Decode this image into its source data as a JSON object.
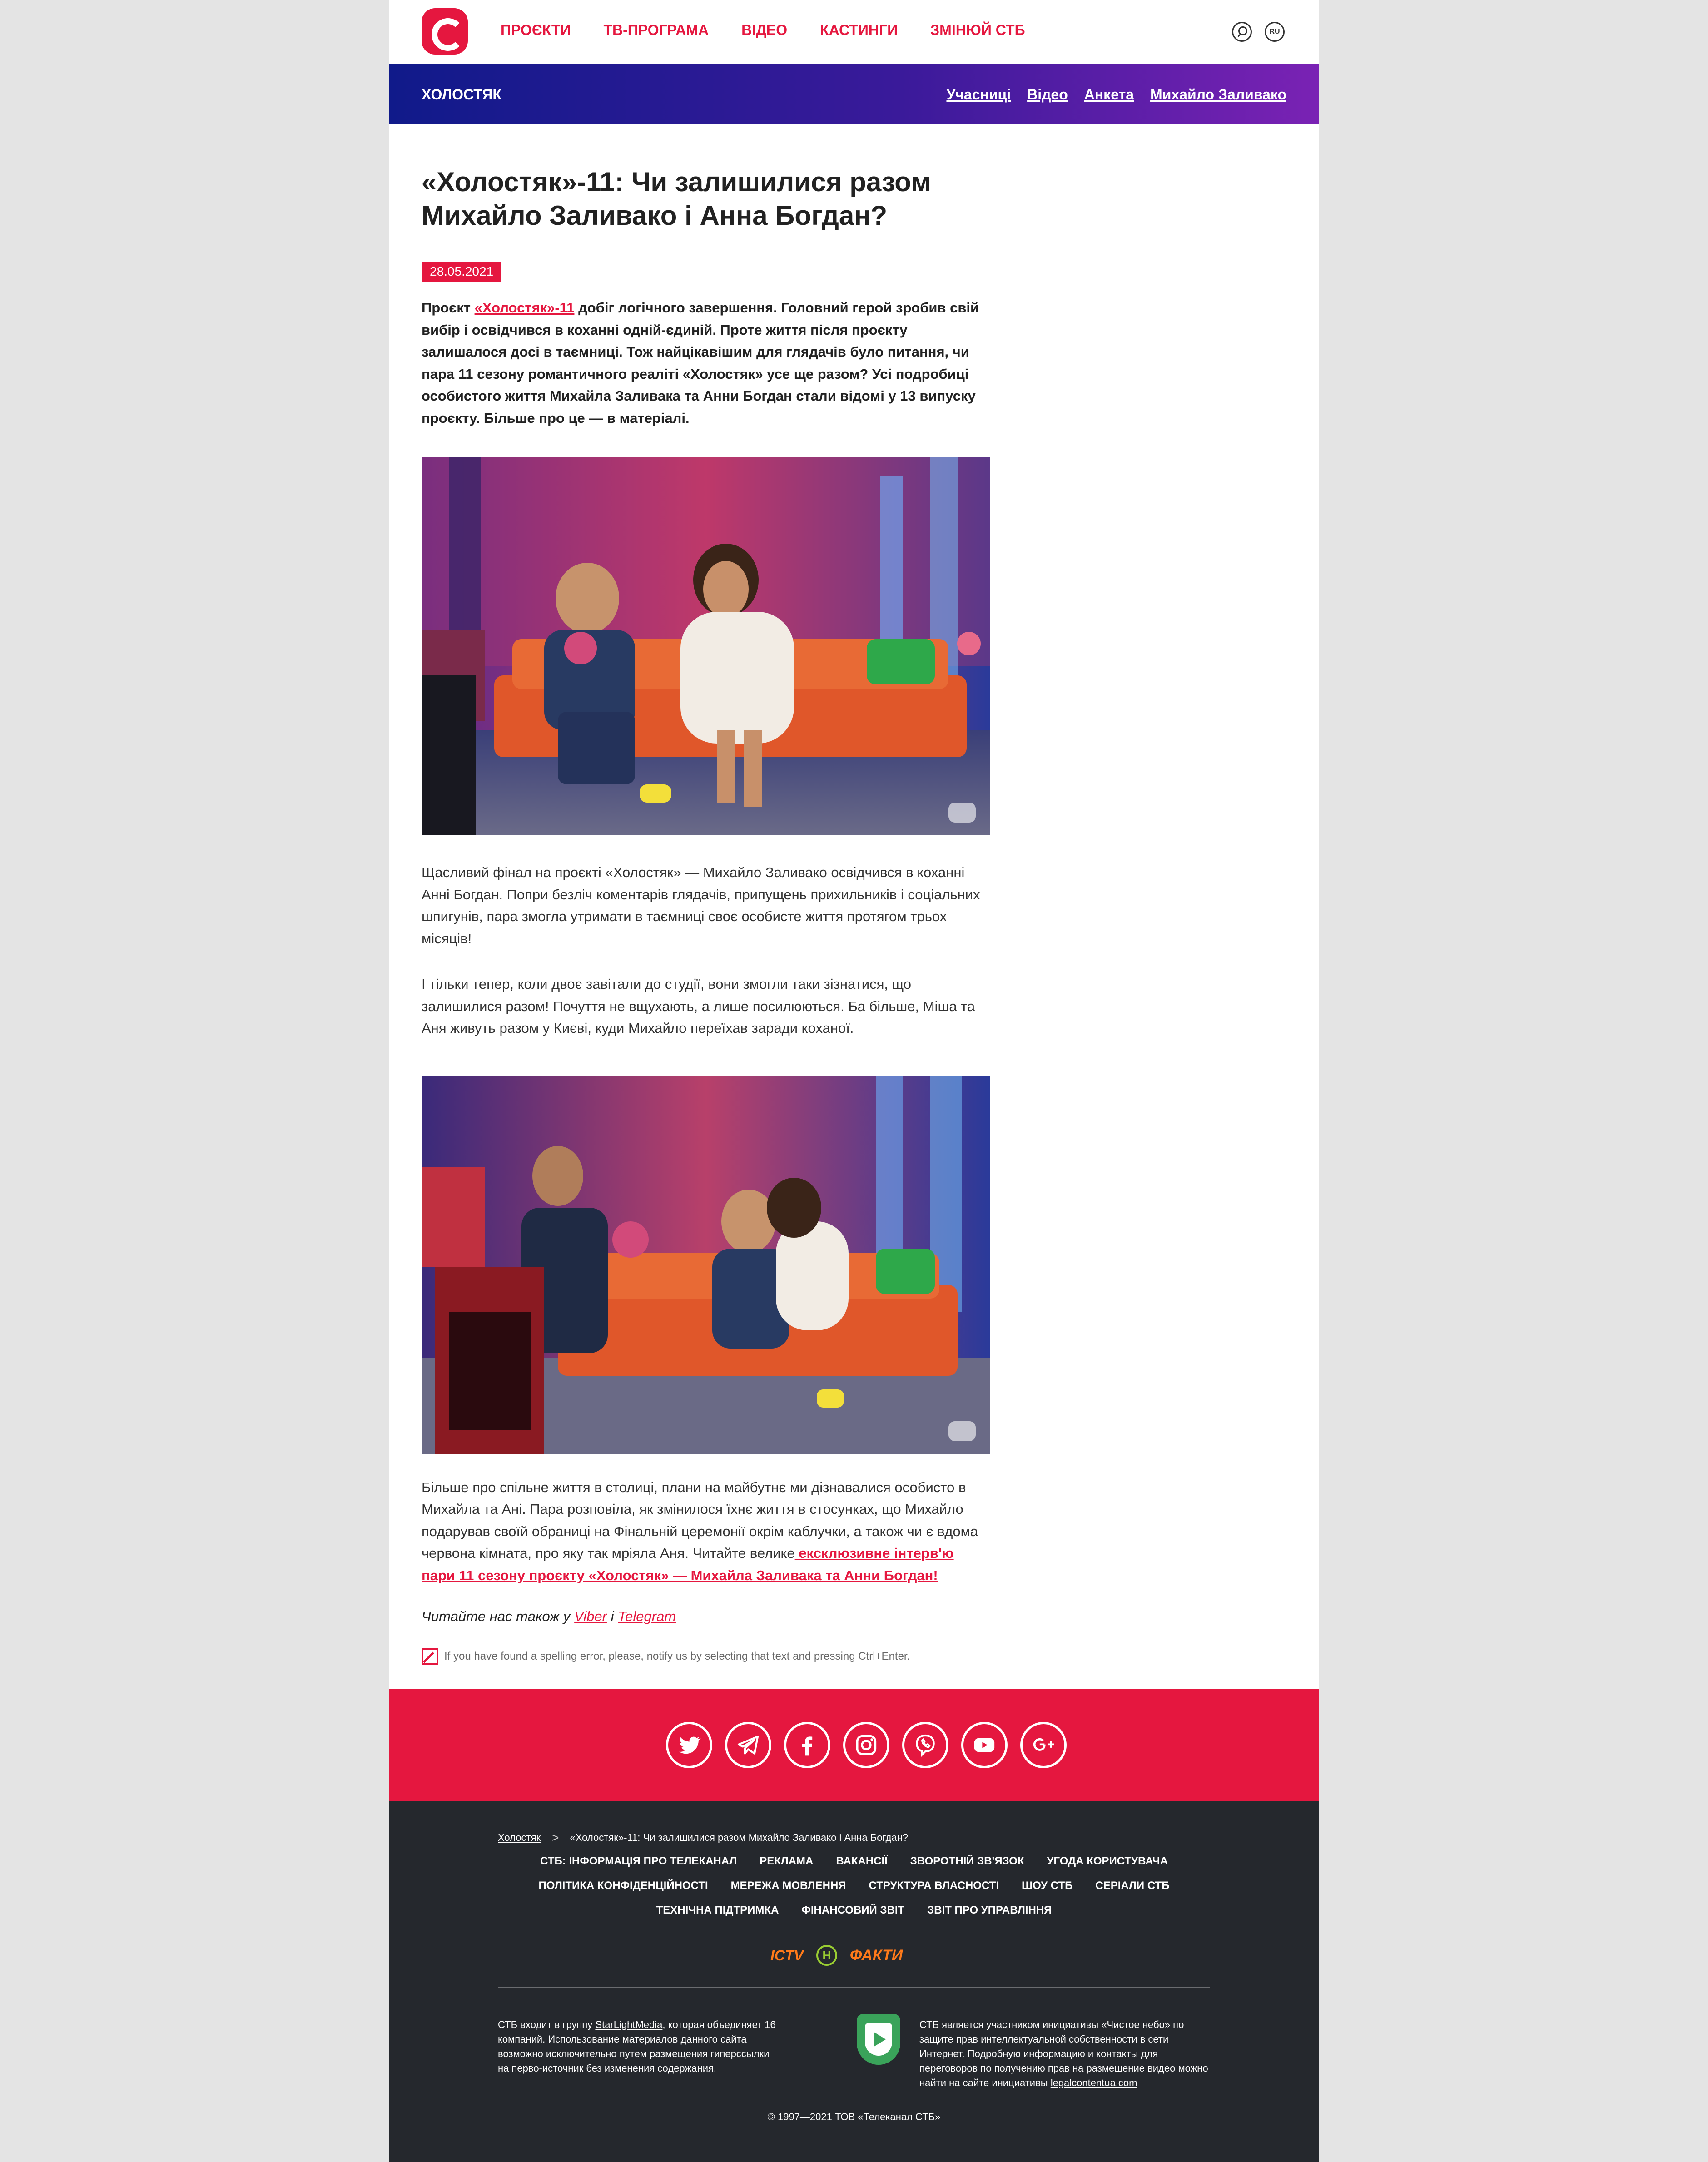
{
  "header": {
    "nav": [
      "ПРОЄКТИ",
      "ТВ-ПРОГРАМА",
      "ВІДЕО",
      "КАСТИНГИ",
      "ЗМІНЮЙ СТБ"
    ],
    "lang": "RU",
    "logo_icon": "stb-logo-icon",
    "search_icon": "search-icon"
  },
  "project_bar": {
    "title": "ХОЛОСТЯК",
    "links": [
      "Учасниці",
      "Відео",
      "Анкета",
      "Михайло Заливако"
    ]
  },
  "article": {
    "title": "«Холостяк»-11: Чи залишилися разом Михайло Заливако і Анна Богдан?",
    "date": "28.05.2021",
    "lead_before": "Проєкт ",
    "lead_link": "«Холостяк»-11",
    "lead_after": " добіг логічного завершення. Головний герой зробив свій вибір і освідчився в коханні одній-єдиній. Проте життя після проєкту залишалося досі в таємниці. Тож найцікавішим для глядачів було питання, чи пара 11 сезону романтичного реаліті «Холостяк» усе ще разом? Усі подробиці особистого життя Михайла Заливака та Анни Богдан стали відомі у 13 випуску проєкту. Більше про це — в матеріалі.",
    "paragraph1": "Щасливий фінал на проєкті «Холостяк» — Михайло Заливако освідчився в коханні Анні Богдан. Попри безліч коментарів глядачів, припущень прихильників і соціальних шпигунів, пара змогла утримати в таємниці своє особисте життя протягом трьох місяців!",
    "paragraph2": "І тільки тепер, коли двоє завітали до студії, вони змогли таки зізнатися, що залишилися разом! Почуття не вщухають, а лише посилюються. Ба більше, Міша та Аня живуть разом у Києві, куди Михайло переїхав заради коханої.",
    "paragraph3_text": "Більше про спільне життя в столиці, плани на майбутнє ми дізнавалися особисто в Михайла та Ані. Пара розповіла, як змінилося їхнє життя в стосунках, що Михайло подарував своїй обраниці на Фінальній церемонії окрім каблучки, а також чи є вдома червона кімната, про яку так мріяла Аня. Читайте велике",
    "paragraph3_link": " ексклюзивне інтерв'ю пари 11 сезону проєкту «Холостяк» — Михайла Заливака та Анни Богдан!",
    "read_us_text": "Читайте нас також у ",
    "read_us_viber": "Viber",
    "read_us_and": " і ",
    "read_us_telegram": "Telegram",
    "spelling_note": "If you have found a spelling error, please, notify us by selecting that text and pressing Ctrl+Enter."
  },
  "social_icons": [
    "twitter-icon",
    "telegram-icon",
    "facebook-icon",
    "instagram-icon",
    "viber-icon",
    "youtube-icon",
    "google-plus-icon"
  ],
  "footer": {
    "breadcrumb_home": "Холостяк",
    "breadcrumb_sep": ">",
    "breadcrumb_current": "«Холостяк»-11: Чи залишилися разом Михайло Заливако і Анна Богдан?",
    "links_row1": [
      "СТБ: ІНФОРМАЦІЯ ПРО ТЕЛЕКАНАЛ",
      "РЕКЛАМА",
      "ВАКАНСІЇ",
      "ЗВОРОТНІЙ ЗВ'ЯЗОК",
      "УГОДА КОРИСТУВАЧА"
    ],
    "links_row2": [
      "ПОЛІТИКА КОНФІДЕНЦІЙНОСТІ",
      "МЕРЕЖА МОВЛЕННЯ",
      "СТРУКТУРА ВЛАСНОСТІ",
      "ШОУ СТБ",
      "СЕРІАЛИ СТБ"
    ],
    "links_row3": [
      "ТЕХНІЧНА ПІДТРИМКА",
      "ФІНАНСОВИЙ ЗВІТ",
      "ЗВІТ ПРО УПРАВЛІННЯ"
    ],
    "brands": [
      "ICTV",
      "Н",
      "ФАКТИ"
    ],
    "left_before": "СТБ входит в группу ",
    "left_link": "StarLightMedia",
    "left_after": ", которая объединяет 16 компаний. Использование материалов данного сайта возможно исключительно путем размещения гиперссылки на перво-источник без изменения содержания.",
    "right_text": "СТБ является участником инициативы «Чистое небо» по защите прав интеллектуальной собственности в сети Интернет. Подробную информацию и контакты для переговоров по получению прав на размещение видео можно найти на сайте инициативы ",
    "right_link": "legalcontentua.com",
    "copyright": "© 1997—2021 ТОВ «Телеканал СТБ»"
  }
}
